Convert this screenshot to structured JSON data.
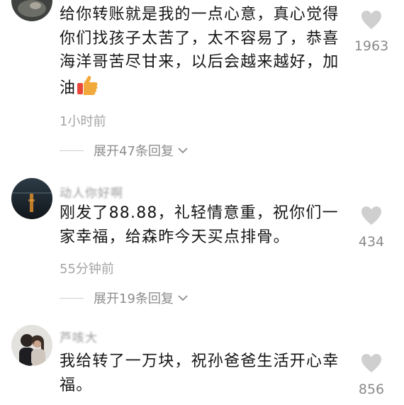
{
  "comments": [
    {
      "avatar_icon": "avatar-photo",
      "username": "",
      "text": "给你转账就是我的一点心意，真心觉得你们找孩子太苦了，太不容易了，恭喜海洋哥苦尽甘来，以后会越来越好，加油",
      "emoji": "thumbs-up-icon",
      "time": "1小时前",
      "replies": "展开47条回复",
      "likes": "1963"
    },
    {
      "avatar_icon": "avatar-sunset-sea",
      "username": "动人你好啊",
      "text": "刚发了88.88，礼轻情意重，祝你们一家幸福，给森昨今天买点排骨。",
      "time": "55分钟前",
      "replies": "展开19条回复",
      "likes": "434"
    },
    {
      "avatar_icon": "avatar-couple-photo",
      "username": "芦咳大",
      "text": "我给转了一万块，祝孙爸爸生活开心幸福。",
      "likes": "856"
    }
  ],
  "colors": {
    "text": "#161616",
    "meta": "#a4a4a4",
    "heart": "#cfcfcf",
    "emoji": "#f2a93b"
  }
}
